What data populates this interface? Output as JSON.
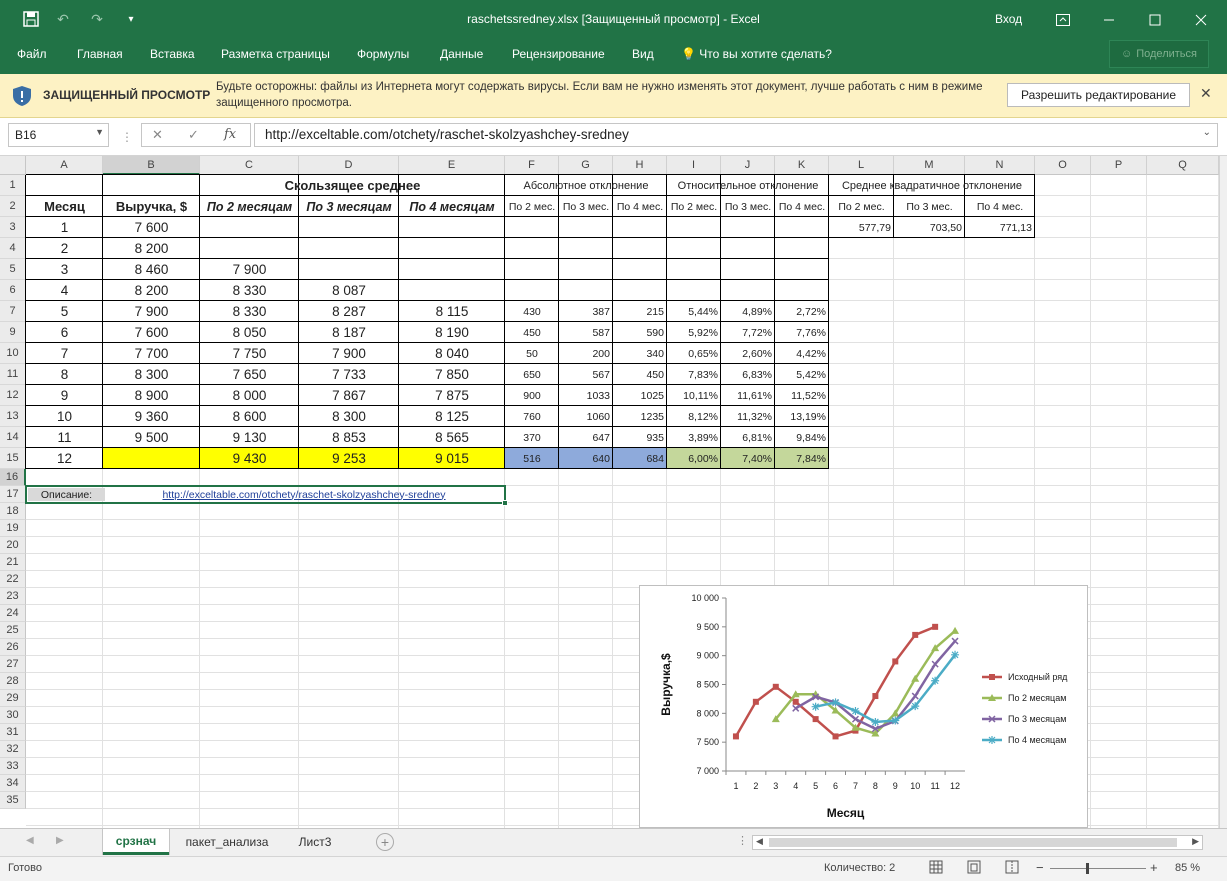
{
  "titlebar": {
    "title": "raschetssredney.xlsx  [Защищенный просмотр]  -  Excel",
    "login": "Вход",
    "icons": [
      "save-icon",
      "undo-icon",
      "redo-icon",
      "customize-icon",
      "ribbon-display-icon",
      "minimize-icon",
      "maximize-icon",
      "close-icon"
    ]
  },
  "ribbon": {
    "tabs": [
      "Файл",
      "Главная",
      "Вставка",
      "Разметка страницы",
      "Формулы",
      "Данные",
      "Рецензирование",
      "Вид",
      "Что вы хотите сделать?"
    ],
    "share": "Поделиться"
  },
  "protected_view": {
    "title": "ЗАЩИЩЕННЫЙ ПРОСМОТР",
    "message": "Будьте осторожны: файлы из Интернета могут содержать вирусы. Если вам не нужно изменять этот документ, лучше работать с ним в режиме защищенного просмотра.",
    "enable_button": "Разрешить редактирование",
    "close": "✕"
  },
  "formula_bar": {
    "name_box": "B16",
    "formula": "http://exceltable.com/otchety/raschet-skolzyashchey-sredney"
  },
  "columns": [
    "A",
    "B",
    "C",
    "D",
    "E",
    "F",
    "G",
    "H",
    "I",
    "J",
    "K",
    "L",
    "M",
    "N",
    "O",
    "P",
    "Q"
  ],
  "rows": [
    "1",
    "2",
    "3",
    "4",
    "5",
    "6",
    "7",
    "9",
    "10",
    "11",
    "12",
    "13",
    "14",
    "15",
    "16",
    "17",
    "18",
    "19",
    "20",
    "21",
    "22",
    "23",
    "24",
    "25",
    "26",
    "27",
    "28",
    "29",
    "30",
    "31",
    "32",
    "33",
    "34",
    "35"
  ],
  "sheet": {
    "row1": {
      "moving_avg": "Скользящее среднее",
      "abs_dev": "Абсолютное отклонение",
      "rel_dev": "Относительное отклонение",
      "std_dev": "Среднее квадратичное отклонение"
    },
    "row2": {
      "month": "Месяц",
      "revenue": "Выручка, $",
      "ma2": "По 2 месяцам",
      "ma3": "По 3 месяцам",
      "ma4": "По 4 месяцам",
      "sub": [
        "По 2 мес.",
        "По 3 мес.",
        "По 4 мес.",
        "По 2 мес.",
        "По 3 мес.",
        "По 4 мес.",
        "По 2 мес.",
        "По 3 мес.",
        "По 4 мес."
      ]
    },
    "std_values": [
      "577,79",
      "703,50",
      "771,13"
    ],
    "data_rows": [
      [
        "1",
        "7 600",
        "",
        "",
        "",
        "",
        "",
        "",
        "",
        "",
        ""
      ],
      [
        "2",
        "8 200",
        "",
        "",
        "",
        "",
        "",
        "",
        "",
        "",
        ""
      ],
      [
        "3",
        "8 460",
        "7 900",
        "",
        "",
        "",
        "",
        "",
        "",
        "",
        ""
      ],
      [
        "4",
        "8 200",
        "8 330",
        "8 087",
        "",
        "",
        "",
        "",
        "",
        "",
        ""
      ],
      [
        "5",
        "7 900",
        "8 330",
        "8 287",
        "8 115",
        "430",
        "387",
        "215",
        "5,44%",
        "4,89%",
        "2,72%"
      ],
      [
        "6",
        "7 600",
        "8 050",
        "8 187",
        "8 190",
        "450",
        "587",
        "590",
        "5,92%",
        "7,72%",
        "7,76%"
      ],
      [
        "7",
        "7 700",
        "7 750",
        "7 900",
        "8 040",
        "50",
        "200",
        "340",
        "0,65%",
        "2,60%",
        "4,42%"
      ],
      [
        "8",
        "8 300",
        "7 650",
        "7 733",
        "7 850",
        "650",
        "567",
        "450",
        "7,83%",
        "6,83%",
        "5,42%"
      ],
      [
        "9",
        "8 900",
        "8 000",
        "7 867",
        "7 875",
        "900",
        "1033",
        "1025",
        "10,11%",
        "11,61%",
        "11,52%"
      ],
      [
        "10",
        "9 360",
        "8 600",
        "8 300",
        "8 125",
        "760",
        "1060",
        "1235",
        "8,12%",
        "11,32%",
        "13,19%"
      ],
      [
        "11",
        "9 500",
        "9 130",
        "8 853",
        "8 565",
        "370",
        "647",
        "935",
        "3,89%",
        "6,81%",
        "9,84%"
      ],
      [
        "12",
        "",
        "9 430",
        "9 253",
        "9 015",
        "516",
        "640",
        "684",
        "6,00%",
        "7,40%",
        "7,84%"
      ]
    ],
    "description_label": "Описание:",
    "description_link": "http://exceltable.com/otchety/raschet-skolzyashchey-sredney",
    "colors": {
      "yellow": "#ffff00",
      "blue": "#8eaadb",
      "green": "#c4d79b",
      "link": "#1f3f99"
    }
  },
  "chart_data": {
    "type": "line",
    "title": "",
    "xlabel": "Месяц",
    "ylabel": "Выручка,$",
    "x": [
      1,
      2,
      3,
      4,
      5,
      6,
      7,
      8,
      9,
      10,
      11,
      12
    ],
    "ylim": [
      7000,
      10000
    ],
    "yticks": [
      "7 000",
      "7 500",
      "8 000",
      "8 500",
      "9 000",
      "9 500",
      "10 000"
    ],
    "legend_position": "right",
    "series": [
      {
        "name": "Исходный ряд",
        "color": "#c0504d",
        "marker": "square",
        "values": [
          7600,
          8200,
          8460,
          8200,
          7900,
          7600,
          7700,
          8300,
          8900,
          9360,
          9500,
          null
        ]
      },
      {
        "name": "По 2 месяцам",
        "color": "#9bbb59",
        "marker": "triangle",
        "values": [
          null,
          null,
          7900,
          8330,
          8330,
          8050,
          7750,
          7650,
          8000,
          8600,
          9130,
          9430
        ]
      },
      {
        "name": "По 3 месяцам",
        "color": "#8064a2",
        "marker": "x",
        "values": [
          null,
          null,
          null,
          8087,
          8287,
          8187,
          7900,
          7733,
          7867,
          8300,
          8853,
          9253
        ]
      },
      {
        "name": "По 4 месяцам",
        "color": "#4bacc6",
        "marker": "star",
        "values": [
          null,
          null,
          null,
          null,
          8115,
          8190,
          8040,
          7850,
          7875,
          8125,
          8565,
          9015
        ]
      }
    ]
  },
  "sheet_tabs": [
    "срзнач",
    "пакет_анализа",
    "Лист3"
  ],
  "status": {
    "ready": "Готово",
    "count": "Количество: 2",
    "zoom": "85 %"
  }
}
